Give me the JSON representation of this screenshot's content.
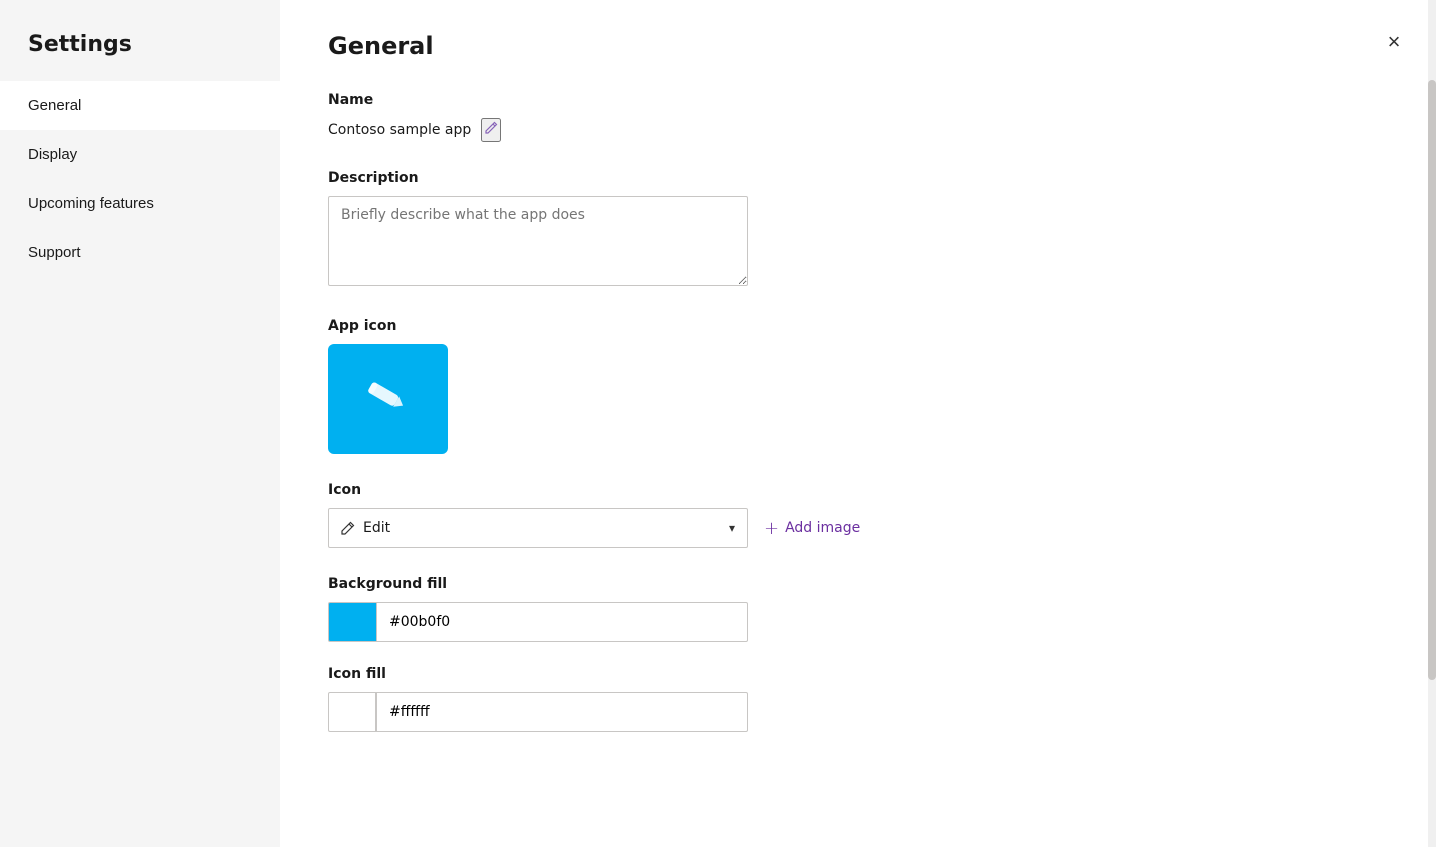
{
  "sidebar": {
    "title": "Settings",
    "items": [
      {
        "id": "general",
        "label": "General",
        "active": true
      },
      {
        "id": "display",
        "label": "Display",
        "active": false
      },
      {
        "id": "upcoming-features",
        "label": "Upcoming features",
        "active": false
      },
      {
        "id": "support",
        "label": "Support",
        "active": false
      }
    ]
  },
  "main": {
    "title": "General",
    "close_label": "×",
    "sections": {
      "name": {
        "label": "Name",
        "value": "Contoso sample app",
        "edit_icon": "✏"
      },
      "description": {
        "label": "Description",
        "placeholder": "Briefly describe what the app does"
      },
      "app_icon": {
        "label": "App icon"
      },
      "icon": {
        "label": "Icon",
        "selected": "Edit",
        "add_image_label": "Add image"
      },
      "background_fill": {
        "label": "Background fill",
        "color": "#00b0f0",
        "color_value": "#00b0f0"
      },
      "icon_fill": {
        "label": "Icon fill",
        "color": "#ffffff",
        "color_value": "#ffffff"
      }
    }
  }
}
